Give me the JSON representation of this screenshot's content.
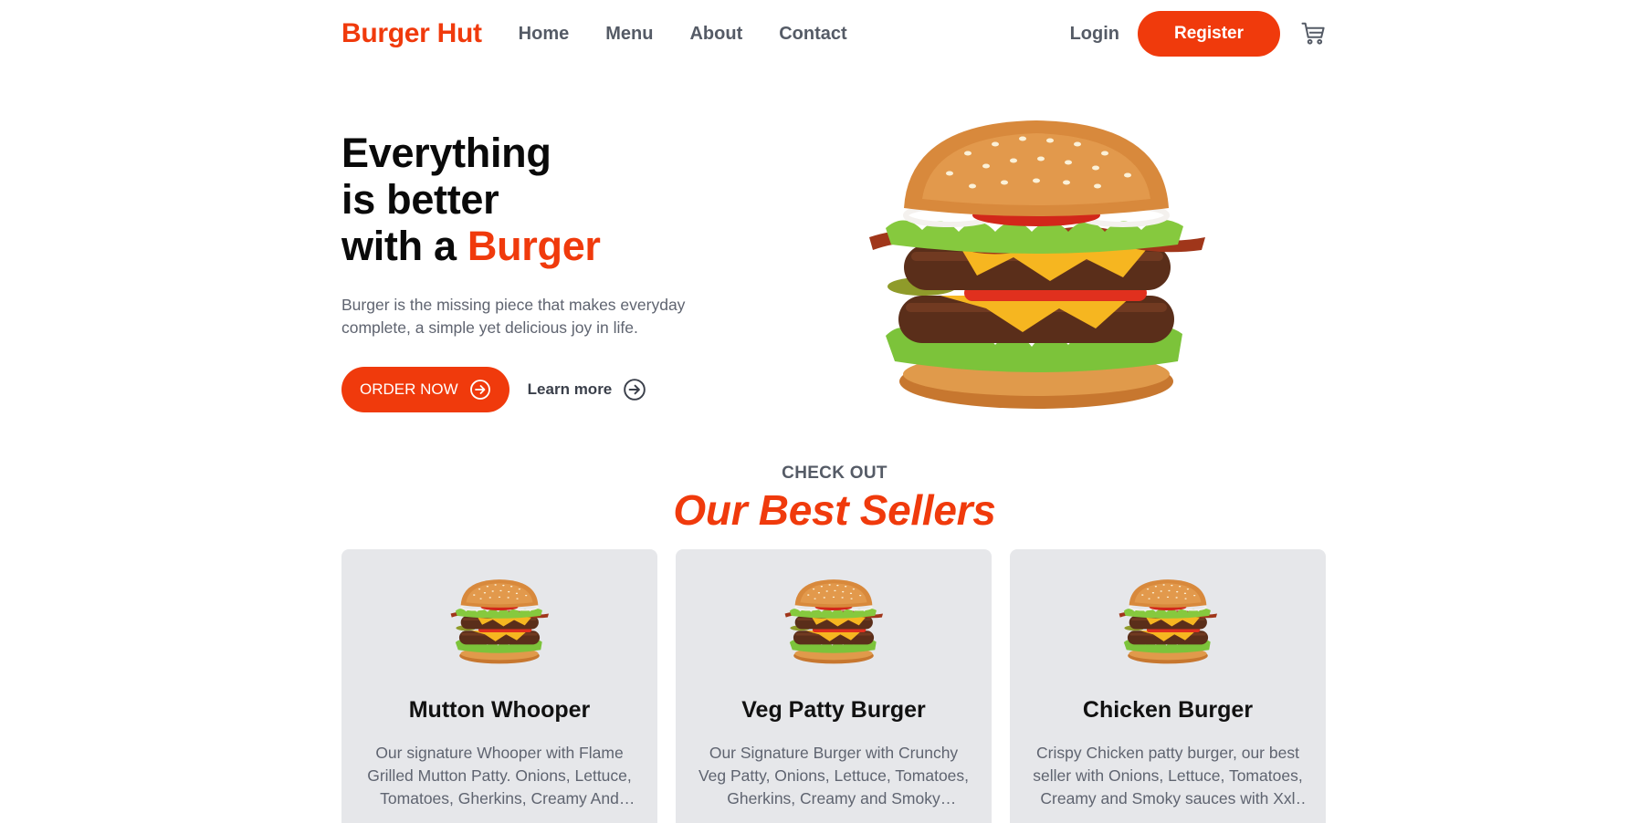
{
  "navbar": {
    "brand": "Burger Hut",
    "links": [
      "Home",
      "Menu",
      "About",
      "Contact"
    ],
    "login_label": "Login",
    "register_label": "Register",
    "cart_icon": "cart-icon"
  },
  "hero": {
    "title_line1": "Everything",
    "title_line2": "is better",
    "title_line3_prefix": "with a ",
    "title_line3_accent": "Burger",
    "description": "Burger is the missing piece that makes everyday complete, a simple yet delicious joy in life.",
    "order_label": "ORDER NOW",
    "learn_label": "Learn more"
  },
  "best_sellers": {
    "eyebrow": "CHECK OUT",
    "title": "Our Best Sellers",
    "items": [
      {
        "name": "Mutton Whooper",
        "description": "Our signature Whooper with Flame Grilled Mutton Patty. Onions, Lettuce, Tomatoes, Gherkins, Creamy And Smoky Sauces."
      },
      {
        "name": "Veg Patty Burger",
        "description": "Our Signature Burger with Crunchy Veg Patty, Onions, Lettuce, Tomatoes, Gherkins, Creamy and Smoky Sauces."
      },
      {
        "name": "Chicken Burger",
        "description": "Crispy Chicken patty burger, our best seller with Onions, Lettuce, Tomatoes, Creamy and Smoky sauces with Xxl patty."
      }
    ]
  },
  "colors": {
    "accent": "#f03a0c",
    "card_bg": "#e6e7ea",
    "muted_text": "#5f6470"
  }
}
